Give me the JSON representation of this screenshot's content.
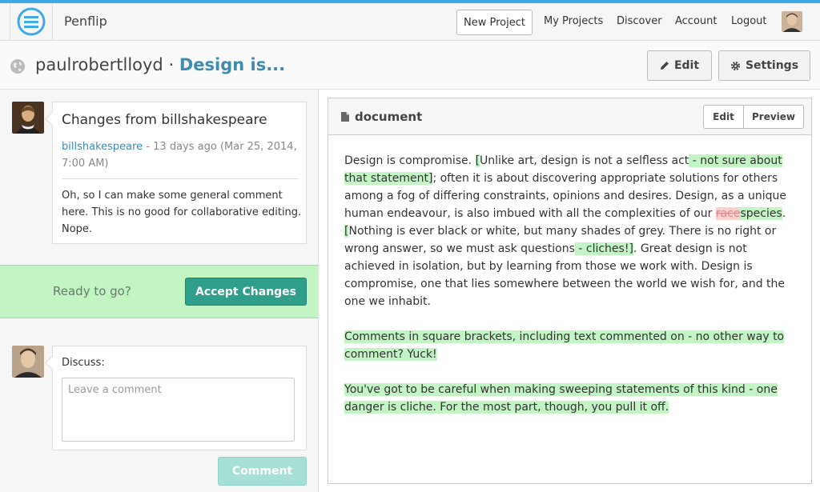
{
  "topbar": {
    "brand": "Penflip",
    "new_project": "New Project",
    "links": [
      "My Projects",
      "Discover",
      "Account",
      "Logout"
    ]
  },
  "header": {
    "owner": "paulrobertlloyd",
    "separator": "·",
    "project": "Design is...",
    "edit_label": "Edit",
    "settings_label": "Settings"
  },
  "changes": {
    "heading": "Changes from billshakespeare",
    "author": "billshakespeare",
    "time": "- 13 days ago (Mar 25, 2014, 7:00 AM)",
    "comment": "Oh, so I can make some general comment here. This is no good for collaborative editing. Nope."
  },
  "ready": {
    "text": "Ready to go?",
    "accept_label": "Accept Changes"
  },
  "discuss": {
    "label": "Discuss:",
    "placeholder": "Leave a comment",
    "comment_label": "Comment"
  },
  "document": {
    "title": "document",
    "tab_edit": "Edit",
    "tab_preview": "Preview",
    "p1": {
      "s1": "Design is compromise. ",
      "s2": "[",
      "s3": "Unlike art, design is not a selfless act",
      "s4": " - not sure about that statement",
      "s5": "]",
      "s6": "; often it is about discovering appropriate solutions for others among a fog of differing constraints, opinions and desires. Design, as a unique human endeavour, is also imbued with all the complexities of our ",
      "s7": "race",
      "s8": "species",
      "s9": ". ",
      "s10": "[",
      "s11": "Nothing is ever black or white, but many shades of grey. There is no right or wrong answer, so we must ask questions",
      "s12": " - cliches!",
      "s13": "]",
      "s14": ". Great design is not achieved in isolation, but by learning from those we work with. Design is compromise, one that lies somewhere between the world we wish for, and the one we inhabit."
    },
    "p2": "Comments in square brackets, including text commented on - no other way to comment? Yuck!",
    "p3": "You've got to be careful when making sweeping statements of this kind - one danger is cliche. For the most part, though, you pull it off."
  },
  "colors": {
    "accent_blue": "#3ea9e6",
    "link": "#3f8bb2",
    "added_bg": "#c2f4c4",
    "removed_bg": "#fbd0d0",
    "accept_button": "#2f9e8a"
  }
}
